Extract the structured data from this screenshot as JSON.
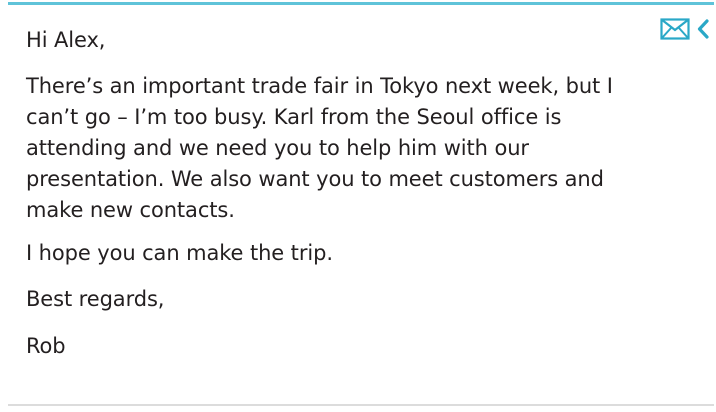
{
  "email": {
    "greeting": "Hi Alex,",
    "body_lines": [
      "There’s an important trade fair in Tokyo next week, but I",
      "can’t go – I’m too busy. Karl from the Seoul office is",
      "attending and we need you to help him with our",
      "presentation. We also want you to meet customers and",
      "make new contacts."
    ],
    "hope_line": "I hope you can make the trip.",
    "closing": "Best regards,",
    "signature": "Rob"
  },
  "toolbar": {
    "icons": [
      "envelope-icon",
      "chevron-left-icon"
    ]
  },
  "colors": {
    "accent": "#5fc3d9",
    "text": "#231f20",
    "icon": "#2aa8c7"
  }
}
